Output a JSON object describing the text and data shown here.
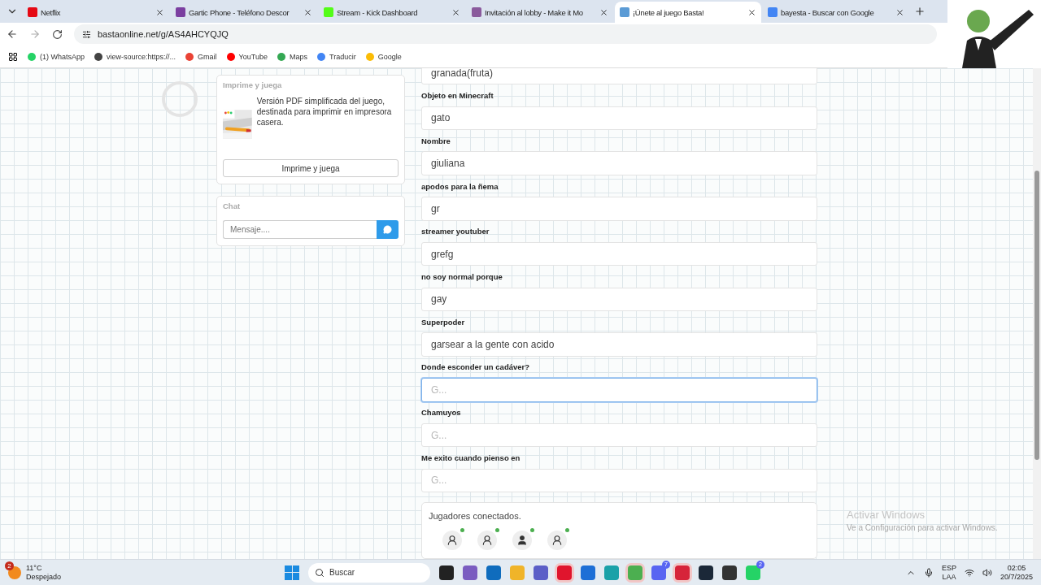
{
  "tabs": [
    {
      "title": "Netflix",
      "color": "#e50914",
      "selected": false
    },
    {
      "title": "Gartic Phone - Teléfono Descor",
      "color": "#7b3fa0",
      "selected": false
    },
    {
      "title": "Stream - Kick Dashboard",
      "color": "#53fc18",
      "selected": false
    },
    {
      "title": "Invitación al lobby - Make it Mo",
      "color": "#8a5a9c",
      "selected": false
    },
    {
      "title": "¡Únete al juego Basta!",
      "color": "#5b9bd5",
      "selected": true
    },
    {
      "title": "bayesta - Buscar con Google",
      "color": "#4285f4",
      "selected": false
    }
  ],
  "address": "bastaonline.net/g/AS4AHCYQJQ",
  "bookmarks": [
    {
      "label": "(1) WhatsApp",
      "color": "#25d366"
    },
    {
      "label": "view-source:https://...",
      "color": "#444444"
    },
    {
      "label": "Gmail",
      "color": "#ea4335"
    },
    {
      "label": "YouTube",
      "color": "#ff0000"
    },
    {
      "label": "Maps",
      "color": "#34a853"
    },
    {
      "label": "Traducir",
      "color": "#4285f4"
    },
    {
      "label": "Google",
      "color": "#fbbc05"
    }
  ],
  "print_card": {
    "title": "Imprime y juega",
    "description": "Versión PDF simplificada del juego, destinada para imprimir en impresora casera.",
    "button": "Imprime y juega"
  },
  "chat": {
    "title": "Chat",
    "placeholder": "Mensaje...."
  },
  "fields": [
    {
      "value": "granada(fruta)",
      "focused": false
    },
    {
      "label": "Objeto en Minecraft",
      "value": "gato",
      "focused": false
    },
    {
      "label": "Nombre",
      "value": "giuliana",
      "focused": false
    },
    {
      "label": "apodos para la ñema",
      "value": "gr",
      "focused": false
    },
    {
      "label": "streamer youtuber",
      "value": "grefg",
      "focused": false
    },
    {
      "label": "no soy normal porque",
      "value": "gay",
      "focused": false
    },
    {
      "label": "Superpoder",
      "value": "garsear a la gente con acido",
      "focused": false
    },
    {
      "label": "Donde esconder un cadáver?",
      "placeholder": "G...",
      "focused": true
    },
    {
      "label": "Chamuyos",
      "placeholder": "G...",
      "focused": false
    },
    {
      "label": "Me exito cuando pienso en",
      "placeholder": "G...",
      "focused": false
    }
  ],
  "players": {
    "title": "Jugadores conectados.",
    "list": [
      {
        "kind": "user",
        "online": true
      },
      {
        "kind": "user",
        "online": true
      },
      {
        "kind": "host",
        "online": true
      },
      {
        "kind": "user",
        "online": true
      }
    ]
  },
  "activation": {
    "title": "Activar Windows",
    "subtitle": "Ve a Configuración para activar Windows."
  },
  "taskbar": {
    "weather_badge": "2",
    "temperature": "11°C",
    "condition": "Despejado",
    "search": "Buscar",
    "apps": [
      {
        "color": "#222222",
        "running": false
      },
      {
        "color": "#7a5cc0",
        "running": false
      },
      {
        "color": "#0f6cbd",
        "running": false
      },
      {
        "color": "#f0b429",
        "running": false
      },
      {
        "color": "#5b5fc7",
        "running": false
      },
      {
        "color": "#e0152d",
        "running": true
      },
      {
        "color": "#1d6fd6",
        "running": false
      },
      {
        "color": "#1aa1a8",
        "running": false
      },
      {
        "color": "#4caf50",
        "running": true
      },
      {
        "color": "#5865f2",
        "running": false,
        "badge": "7"
      },
      {
        "color": "#d6243a",
        "running": true
      },
      {
        "color": "#1b2838",
        "running": false
      },
      {
        "color": "#333333",
        "running": false
      },
      {
        "color": "#25d366",
        "running": false,
        "badge": "2"
      }
    ],
    "lang": "ESP",
    "layout": "LAA",
    "time": "02:05",
    "date": "20/7/2025"
  }
}
